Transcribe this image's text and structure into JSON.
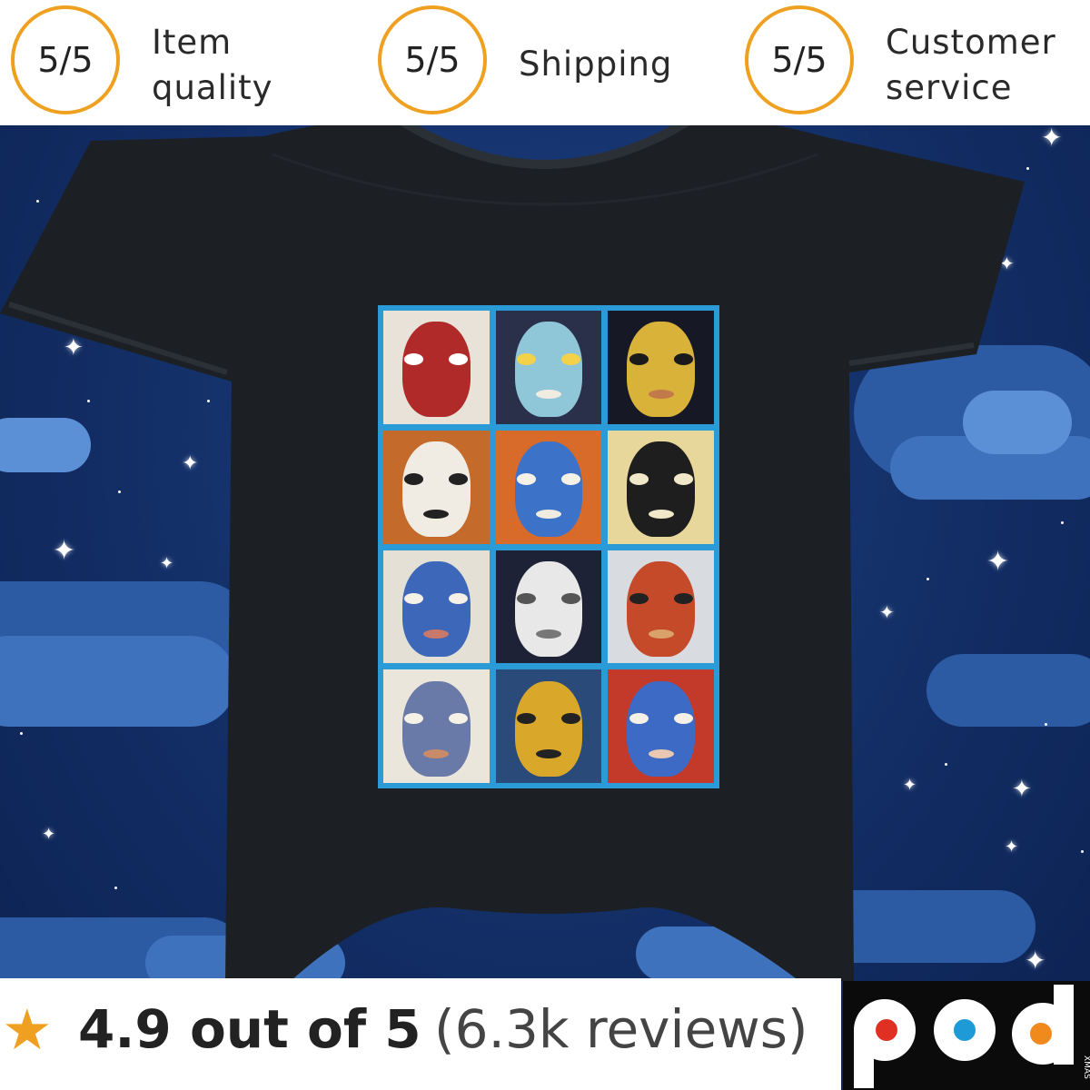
{
  "ratings": [
    {
      "score": "5/5",
      "label_line1": "Item",
      "label_line2": "quality"
    },
    {
      "score": "5/5",
      "label_line1": "Shipping",
      "label_line2": ""
    },
    {
      "score": "5/5",
      "label_line1": "Customer",
      "label_line2": "service"
    }
  ],
  "review": {
    "star_icon": "star-icon",
    "score_text": "4.9 out of 5",
    "count_text": "(6.3k reviews)"
  },
  "logo": {
    "text": "pod",
    "small_text": "XMAS",
    "colors": {
      "red": "#e03024",
      "blue": "#1e9ad6",
      "orange": "#f08a1c"
    }
  },
  "colors": {
    "accent": "#f0a020",
    "onesie": "#1c2025",
    "print_border": "#2a9bd6"
  }
}
